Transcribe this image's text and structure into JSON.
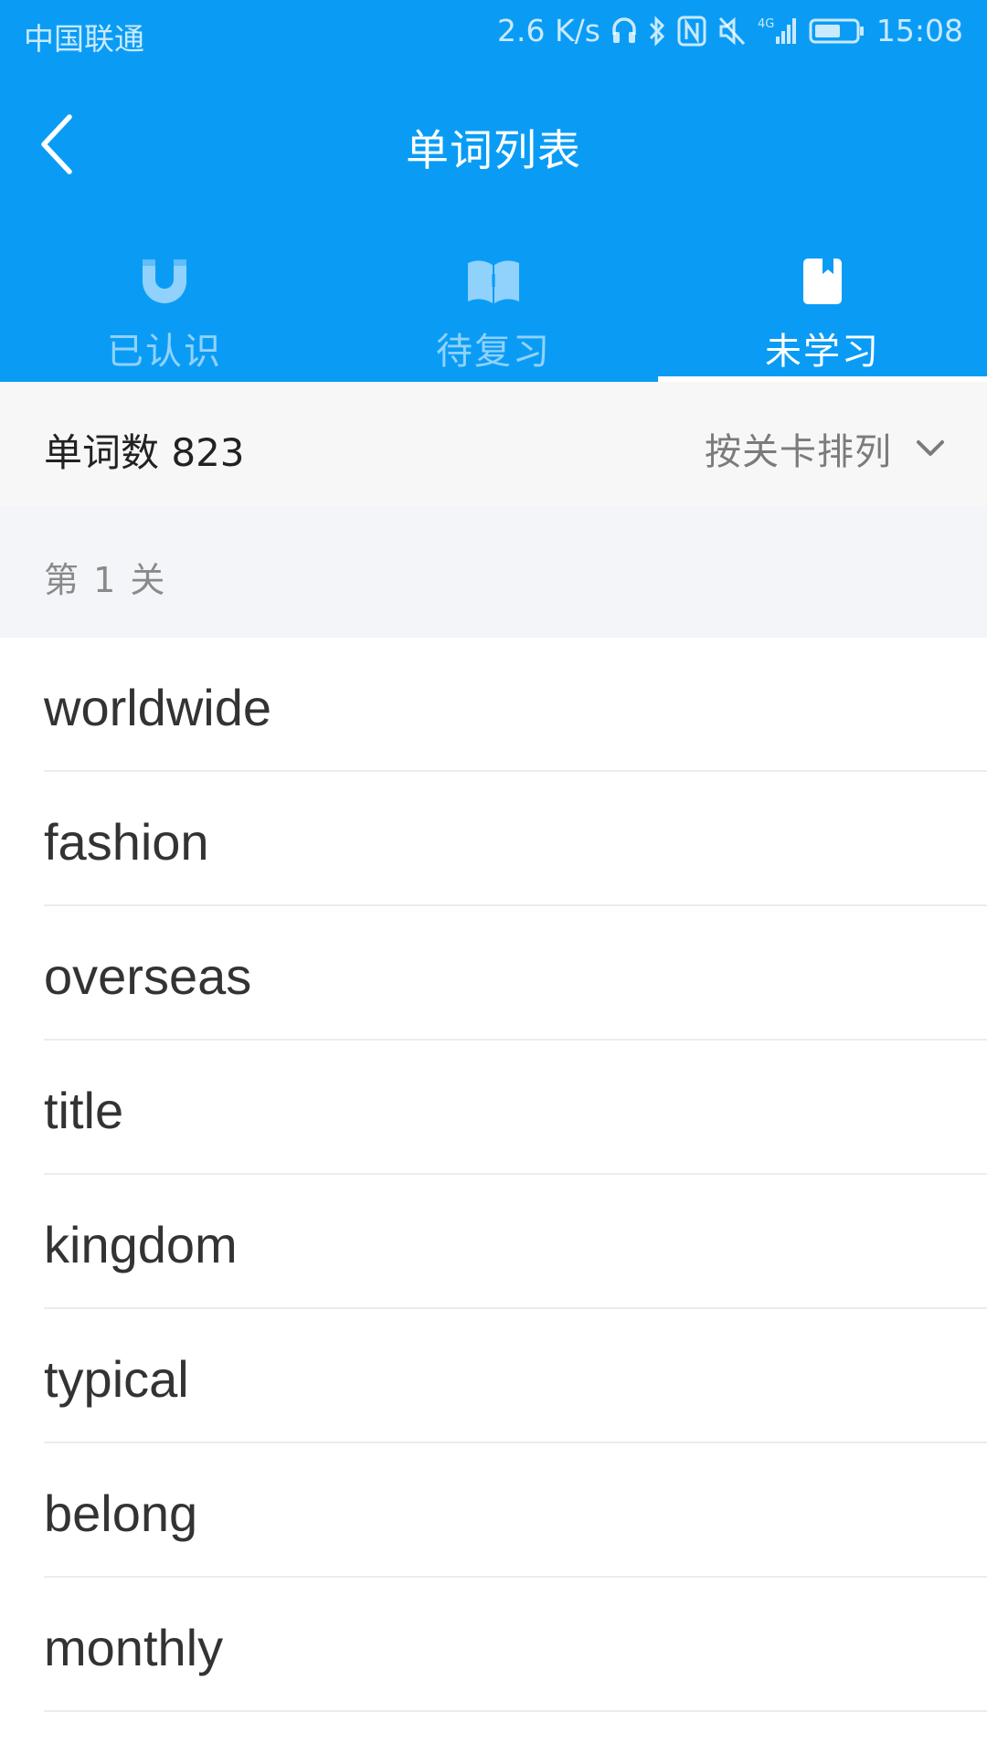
{
  "status_bar": {
    "carrier": "中国联通",
    "net_speed": "2.6 K/s",
    "network": "4G",
    "time": "15:08"
  },
  "nav": {
    "title": "单词列表",
    "back_icon": "chevron-left-icon"
  },
  "tabs": [
    {
      "label": "已认识",
      "icon": "magnet-icon",
      "active": false
    },
    {
      "label": "待复习",
      "icon": "open-book-icon",
      "active": false
    },
    {
      "label": "未学习",
      "icon": "bookmark-icon",
      "active": true
    }
  ],
  "summary": {
    "word_count": "单词数 823",
    "sort_label": "按关卡排列",
    "sort_icon": "chevron-down-icon"
  },
  "section": {
    "title": "第 1 关"
  },
  "words": [
    "worldwide",
    "fashion",
    "overseas",
    "title",
    "kingdom",
    "typical",
    "belong",
    "monthly"
  ],
  "colors": {
    "primary": "#0a9cf5",
    "summary_bg": "#f7f7f7",
    "section_bg": "#f3f5f8",
    "text_primary": "#333333",
    "text_secondary": "#8a8a8a"
  }
}
